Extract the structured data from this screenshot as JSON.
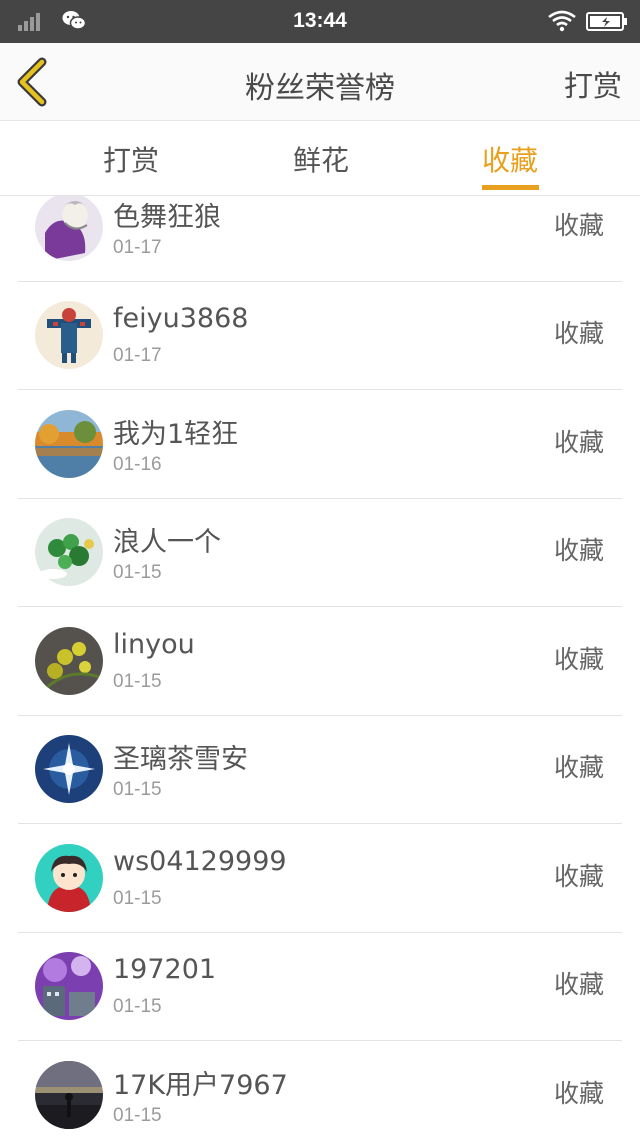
{
  "status_bar": {
    "time": "13:44",
    "icons": [
      "signal-icon",
      "wechat-icon",
      "wifi-icon",
      "battery-charging-icon"
    ]
  },
  "header": {
    "title": "粉丝荣誉榜",
    "right_label": "打赏",
    "back_icon": "chevron-left-icon"
  },
  "tabs": [
    {
      "label": "打赏",
      "active": false
    },
    {
      "label": "鲜花",
      "active": false
    },
    {
      "label": "收藏",
      "active": true
    }
  ],
  "colors": {
    "accent": "#e7a11f",
    "status_bar": "#454545"
  },
  "rows": [
    {
      "name": "色舞狂狼",
      "date": "01-17",
      "action": "收藏"
    },
    {
      "name": "feiyu3868",
      "date": "01-17",
      "action": "收藏"
    },
    {
      "name": "我为1轻狂",
      "date": "01-16",
      "action": "收藏"
    },
    {
      "name": "浪人一个",
      "date": "01-15",
      "action": "收藏"
    },
    {
      "name": "linyou",
      "date": "01-15",
      "action": "收藏"
    },
    {
      "name": "圣璃茶雪安",
      "date": "01-15",
      "action": "收藏"
    },
    {
      "name": "ws04129999",
      "date": "01-15",
      "action": "收藏"
    },
    {
      "name": "197201",
      "date": "01-15",
      "action": "收藏"
    },
    {
      "name": "17K用户7967",
      "date": "01-15",
      "action": "收藏"
    }
  ]
}
